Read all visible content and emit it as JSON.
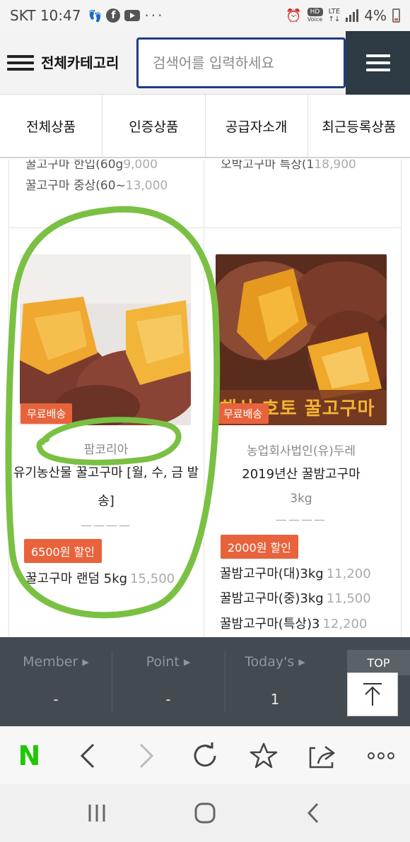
{
  "status_bar": {
    "carrier_time": "SKT 10:47",
    "battery": "4%",
    "network": "LTE",
    "hd_label": "HD",
    "voice_label": "Voice",
    "more": "···"
  },
  "header": {
    "category_label": "전체카테고리",
    "search_placeholder": "검색어를 입력하세요"
  },
  "tabs": [
    {
      "label": "전체상품"
    },
    {
      "label": "인증상품"
    },
    {
      "label": "공급자소개"
    },
    {
      "label": "최근등록상품"
    }
  ],
  "prev_row": {
    "left": [
      {
        "name": "꿀고구마 한입(60g",
        "price": "9,000"
      },
      {
        "name": "꿀고구마 중상(60~",
        "price": "13,000"
      }
    ],
    "right": [
      {
        "name": "오박고구마 특상(1",
        "price": "18,900"
      }
    ]
  },
  "products": [
    {
      "badge": "무료배송",
      "seller": "팜코리아",
      "name": "유기농산물 꿀고구마 [월, 수, 금 발송]",
      "weight": "",
      "divider": "————",
      "discount": "6500원 할인",
      "options": [
        {
          "name": "꿀고구마 랜덤 5kg",
          "price": "15,500"
        }
      ]
    },
    {
      "badge": "무료배송",
      "banner_text": "해산 호토 꿀고구마",
      "seller": "농업회사법인(유)두레",
      "name": "2019년산 꿀밤고구마",
      "weight": "3kg",
      "divider": "————",
      "discount": "2000원 할인",
      "options": [
        {
          "name": "꿀밤고구마(대)3kg",
          "price": "11,200"
        },
        {
          "name": "꿀밤고구마(중)3kg",
          "price": "11,500"
        },
        {
          "name": "꿀밤고구마(특상)3",
          "price": "12,200"
        }
      ]
    }
  ],
  "site_bar": {
    "member": {
      "label": "Member ▸",
      "value": "-"
    },
    "point": {
      "label": "Point ▸",
      "value": "-"
    },
    "today": {
      "label": "Today's ▸",
      "value": "1"
    },
    "top_label": "TOP"
  },
  "browser": {
    "logo": "N"
  },
  "colors": {
    "accent_orange": "#e8633c",
    "search_border": "#1f3c88",
    "annotation_green": "#7ac043",
    "naver_green": "#1ec800"
  },
  "icons": [
    "menu-icon",
    "back-icon",
    "forward-icon",
    "refresh-icon",
    "star-icon",
    "share-icon",
    "more-icon",
    "arrow-up-icon",
    "recents-icon",
    "home-icon",
    "nav-back-icon"
  ]
}
